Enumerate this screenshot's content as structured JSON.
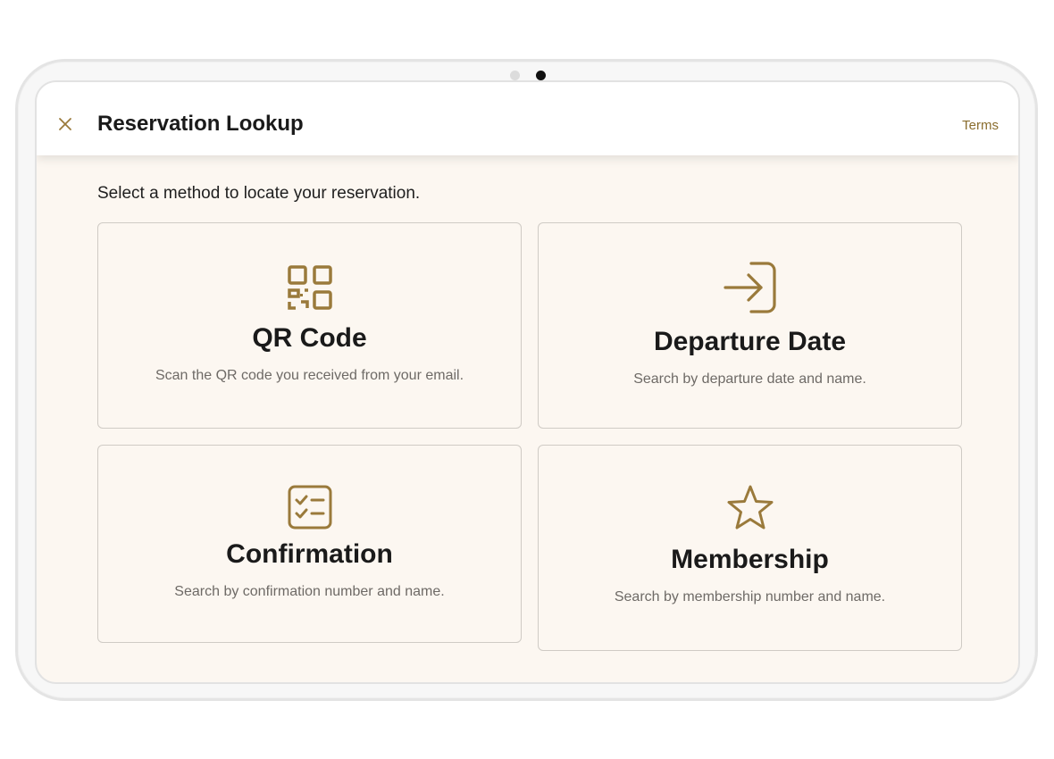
{
  "header": {
    "title": "Reservation Lookup",
    "terms_label": "Terms"
  },
  "instructions": "Select a method to locate your reservation.",
  "methods": [
    {
      "title": "QR Code",
      "description": "Scan the QR code you received from your email.",
      "icon": "qr-code-icon"
    },
    {
      "title": "Departure Date",
      "description": "Search by departure date and name.",
      "icon": "sign-in-arrow-icon"
    },
    {
      "title": "Confirmation",
      "description": "Search by confirmation number and name.",
      "icon": "checklist-icon"
    },
    {
      "title": "Membership",
      "description": "Search by membership number and name.",
      "icon": "star-icon"
    }
  ],
  "colors": {
    "accent": "#9a7a3b",
    "link": "#8a6d2e",
    "screen_background": "#fcf7f1",
    "card_border": "#cfcbc5"
  }
}
